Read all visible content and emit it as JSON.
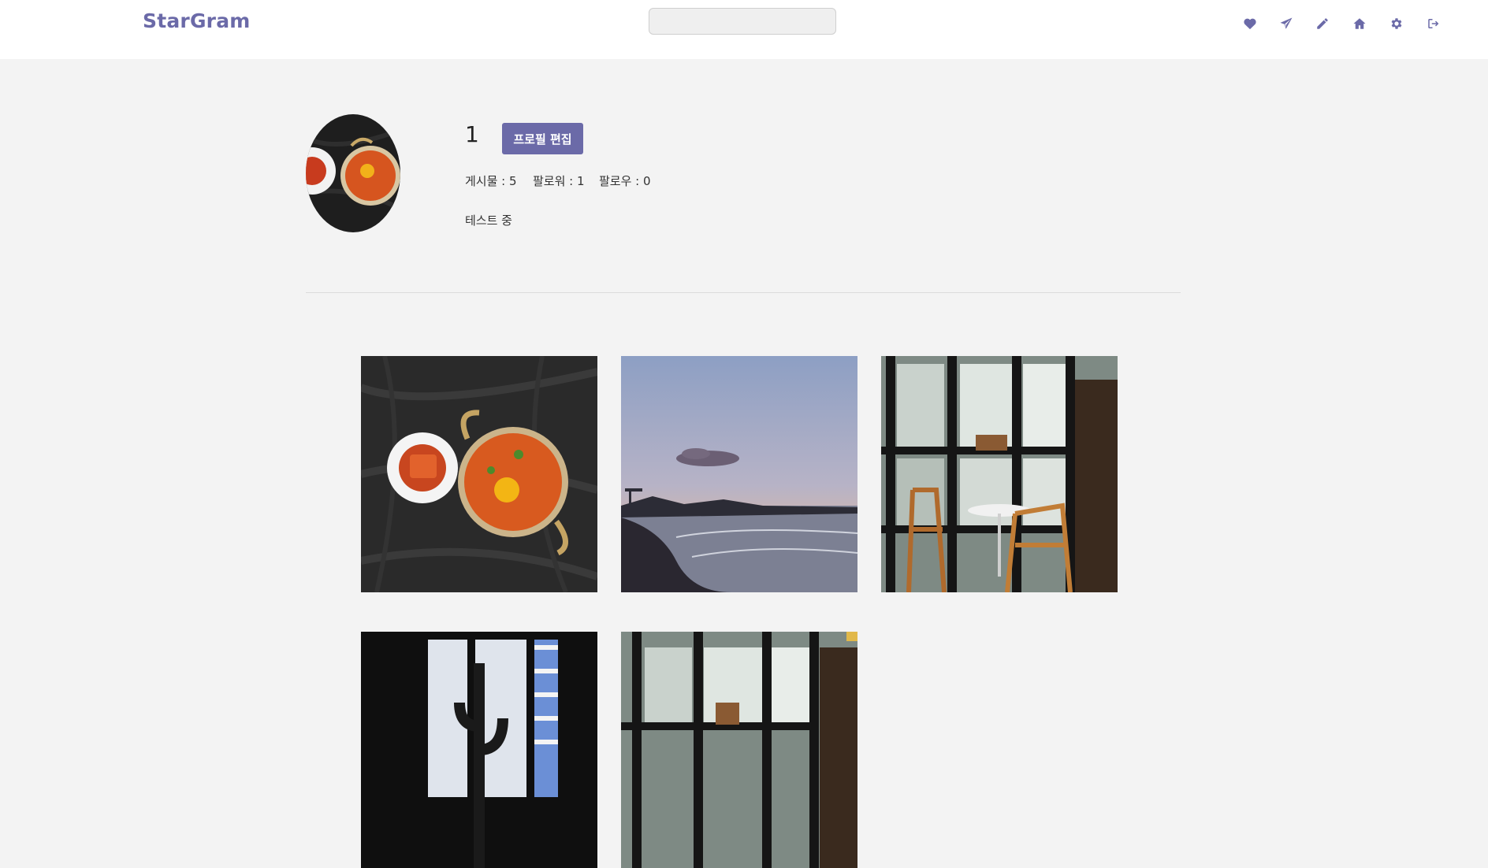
{
  "header": {
    "brand": "StarGram",
    "search": {
      "value": "",
      "placeholder": ""
    },
    "icons": [
      "heart-icon",
      "paper-plane-icon",
      "pencil-icon",
      "home-icon",
      "gear-icon",
      "sign-out-icon"
    ]
  },
  "profile": {
    "username": "1",
    "edit_button": "프로필 편집",
    "stats": {
      "posts": "게시물 : 5",
      "followers": "팔로워 : 1",
      "following": "팔로우 : 0"
    },
    "bio": "테스트 중"
  },
  "posts": [
    {
      "subject": "ramen-photo"
    },
    {
      "subject": "seaside-sunset-photo"
    },
    {
      "subject": "cafe-interior-photo"
    },
    {
      "subject": "cactus-window-photo"
    },
    {
      "subject": "cafe-shelves-photo"
    }
  ],
  "colors": {
    "accent": "#6b6aa8",
    "background": "#f3f3f3",
    "header_bg": "#ffffff"
  }
}
